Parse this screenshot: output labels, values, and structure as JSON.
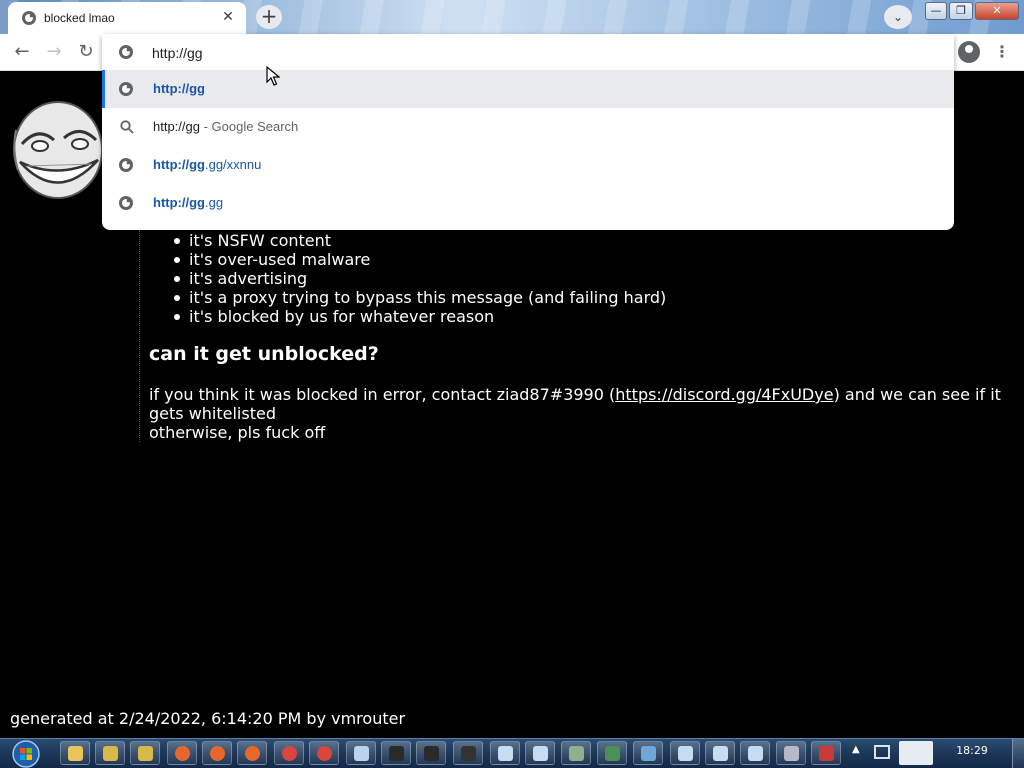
{
  "tab": {
    "title": "blocked lmao",
    "close_glyph": "✕",
    "new_tab_glyph": "+",
    "search_tabs_glyph": "⌄"
  },
  "window_controls": {
    "minimize": "—",
    "maximize": "❐",
    "close": "✕"
  },
  "nav": {
    "back": "←",
    "forward": "→",
    "reload": "↻"
  },
  "omnibox": {
    "value": "http://gg",
    "menu": "⋮"
  },
  "suggestions": [
    {
      "icon": "globe-icon",
      "bold": "http://gg",
      "rest": "",
      "selected": true
    },
    {
      "icon": "search-icon",
      "plain": "http://gg",
      "desc": " - Google Search"
    },
    {
      "icon": "globe-icon",
      "bold": "http://gg",
      "rest": ".gg/xxnnu"
    },
    {
      "icon": "globe-icon",
      "bold": "http://gg",
      "rest": ".gg"
    }
  ],
  "page": {
    "reasons": [
      "it's NSFW content",
      "it's over-used malware",
      "it's advertising",
      "it's a proxy trying to bypass this message (and failing hard)",
      "it's blocked by us for whatever reason"
    ],
    "heading": "can it get unblocked?",
    "para_before": "if you think it was blocked in error, contact ziad87#3990 (",
    "link": "https://discord.gg/4FxUDye",
    "para_after": ") and we can see if it gets whitelisted",
    "para_line2": "otherwise, pls fuck off",
    "generated": "generated at 2/24/2022, 6:14:20 PM by vmrouter"
  },
  "taskbar": {
    "clock": "18:29",
    "icons": [
      "folder-icon",
      "explorer-icon",
      "explorer-icon",
      "firefox-icon",
      "firefox-icon",
      "firefox-icon",
      "chrome-icon",
      "chrome-icon",
      "window-icon",
      "cmd-icon",
      "cmd-icon",
      "7zip-icon",
      "doc-icon",
      "doc-icon",
      "network-icon",
      "monitor-icon",
      "settings-icon",
      "doc-icon",
      "doc-icon",
      "doc-icon",
      "printer-icon",
      "fax-icon"
    ]
  },
  "colors": {
    "link_blue": "#1a56a8",
    "page_bg": "#000000",
    "text": "#ffffff"
  }
}
